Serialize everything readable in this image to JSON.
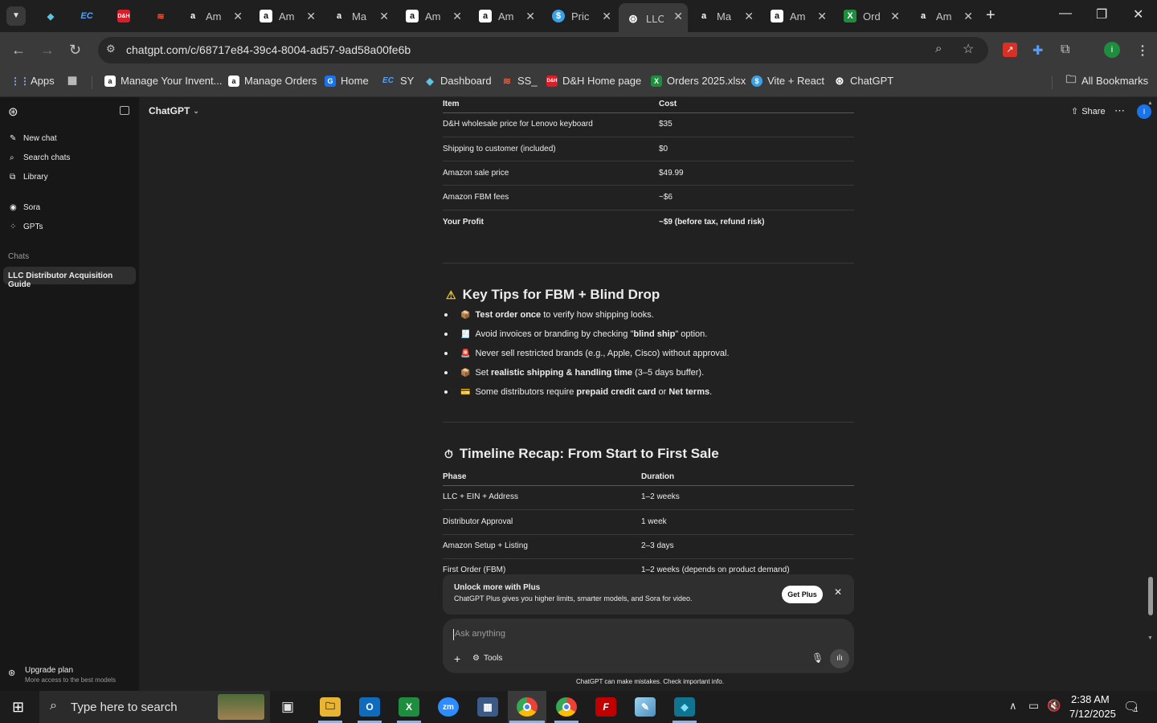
{
  "browser": {
    "tabs": [
      {
        "title": "",
        "favicon": "feather",
        "color": "#5ec4e0"
      },
      {
        "title": "",
        "favicon": "EC",
        "color": "#1a73e8"
      },
      {
        "title": "",
        "favicon": "D&H",
        "color": "#d91e2a"
      },
      {
        "title": "",
        "favicon": "stack",
        "color": "#ef5b3a"
      },
      {
        "title": "Am",
        "favicon": "a",
        "color": "#ffffff"
      },
      {
        "title": "Am",
        "favicon": "a",
        "color": "#ffffff"
      },
      {
        "title": "Ma",
        "favicon": "a",
        "color": "#ffffff"
      },
      {
        "title": "Am",
        "favicon": "a",
        "color": "#ffffff"
      },
      {
        "title": "Am",
        "favicon": "a",
        "color": "#ffffff"
      },
      {
        "title": "Pric",
        "favicon": "$",
        "color": "#3aa0e8"
      },
      {
        "title": "LLC",
        "favicon": "openai",
        "color": "#ffffff"
      },
      {
        "title": "Ma",
        "favicon": "a",
        "color": "#ffffff"
      },
      {
        "title": "Am",
        "favicon": "a",
        "color": "#ffffff"
      },
      {
        "title": "Ord",
        "favicon": "X",
        "color": "#1e8e3e"
      },
      {
        "title": "Am",
        "favicon": "a",
        "color": "#ffffff"
      }
    ],
    "url": "chatgpt.com/c/68717e84-39c4-8004-ad57-9ad58a00fe6b",
    "bookmarks": [
      {
        "label": "Apps"
      },
      {
        "label": "Manage Your Invent..."
      },
      {
        "label": "Manage Orders"
      },
      {
        "label": "Home"
      },
      {
        "label": "SY"
      },
      {
        "label": "Dashboard"
      },
      {
        "label": "SS_"
      },
      {
        "label": "D&H Home page"
      },
      {
        "label": "Orders 2025.xlsx"
      },
      {
        "label": "Vite + React"
      },
      {
        "label": "ChatGPT"
      }
    ],
    "all_bookmarks": "All Bookmarks"
  },
  "sidebar": {
    "new_chat": "New chat",
    "search_chats": "Search chats",
    "library": "Library",
    "sora": "Sora",
    "gpts": "GPTs",
    "chats_heading": "Chats",
    "active_chat": "LLC Distributor Acquisition Guide",
    "upgrade_title": "Upgrade plan",
    "upgrade_sub": "More access to the best models"
  },
  "header": {
    "model": "ChatGPT",
    "share": "Share",
    "avatar": "I"
  },
  "cost_table": {
    "headers": [
      "Item",
      "Cost"
    ],
    "rows": [
      [
        "D&H wholesale price for Lenovo keyboard",
        "$35"
      ],
      [
        "Shipping to customer (included)",
        "$0"
      ],
      [
        "Amazon sale price",
        "$49.99"
      ],
      [
        "Amazon FBM fees",
        "~$6"
      ],
      [
        "Your Profit",
        "~$9 (before tax, refund risk)"
      ]
    ]
  },
  "tips": {
    "heading": "Key Tips for FBM + Blind Drop",
    "items": [
      {
        "emoji": "📦",
        "bold": "Test order once",
        "rest": " to verify how shipping looks."
      },
      {
        "emoji": "🧾",
        "pre": "Avoid invoices or branding by checking \"",
        "bold": "blind ship",
        "rest": "\" option."
      },
      {
        "emoji": "🚨",
        "pre": "Never sell restricted brands (e.g., Apple, Cisco) without approval.",
        "bold": "",
        "rest": ""
      },
      {
        "emoji": "📦",
        "pre": "Set ",
        "bold": "realistic shipping & handling time",
        "rest": " (3–5 days buffer)."
      },
      {
        "emoji": "💳",
        "pre": "Some distributors require ",
        "bold": "prepaid credit card",
        "rest": " or ",
        "bold2": "Net terms",
        "rest2": "."
      }
    ]
  },
  "timeline": {
    "heading": "Timeline Recap: From Start to First Sale",
    "headers": [
      "Phase",
      "Duration"
    ],
    "rows": [
      [
        "LLC + EIN + Address",
        "1–2 weeks"
      ],
      [
        "Distributor Approval",
        "1 week"
      ],
      [
        "Amazon Setup + Listing",
        "2–3 days"
      ],
      [
        "First Order (FBM)",
        "1–2 weeks (depends on product demand)"
      ]
    ]
  },
  "plus_banner": {
    "title": "Unlock more with Plus",
    "body": "ChatGPT Plus gives you higher limits, smarter models, and Sora for video.",
    "button": "Get Plus"
  },
  "composer": {
    "placeholder": "Ask anything",
    "tools": "Tools"
  },
  "disclaimer": "ChatGPT can make mistakes. Check important info.",
  "taskbar": {
    "search_placeholder": "Type here to search",
    "time": "2:38 AM",
    "date": "7/12/2025",
    "notifications": "1"
  }
}
